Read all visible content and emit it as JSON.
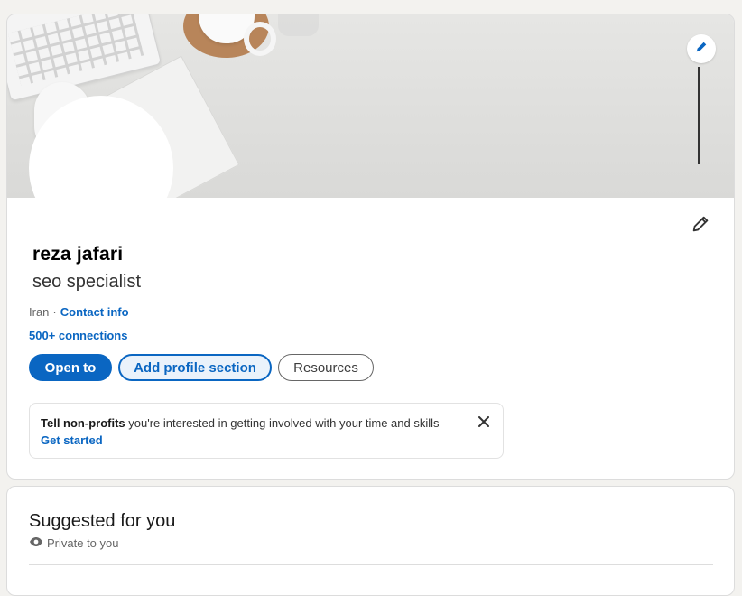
{
  "profile": {
    "name": "reza jafari",
    "headline": "seo specialist",
    "location": "Iran",
    "separator": "·",
    "contact_info": "Contact info",
    "connections": "500+ connections"
  },
  "actions": {
    "open_to": "Open to",
    "add_profile_section": "Add profile section",
    "resources": "Resources"
  },
  "notice": {
    "bold_text": "Tell non-profits",
    "text": " you're interested in getting involved with your time and skills",
    "link": "Get started"
  },
  "suggested": {
    "title": "Suggested for you",
    "privacy": "Private to you"
  },
  "colors": {
    "accent": "#0a66c2",
    "background": "#f3f2ef"
  }
}
